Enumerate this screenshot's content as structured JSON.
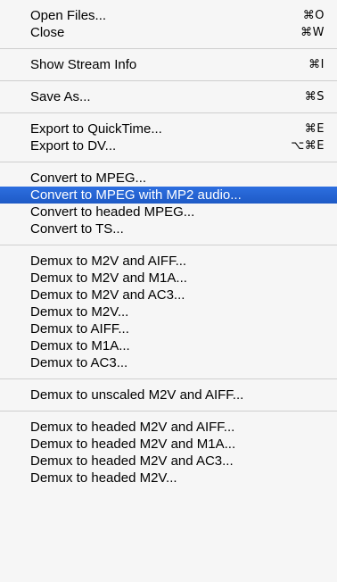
{
  "menu": {
    "groups": [
      [
        {
          "label": "Open Files...",
          "shortcut": "⌘O"
        },
        {
          "label": "Close",
          "shortcut": "⌘W"
        }
      ],
      [
        {
          "label": "Show Stream Info",
          "shortcut": "⌘I"
        }
      ],
      [
        {
          "label": "Save As...",
          "shortcut": "⌘S"
        }
      ],
      [
        {
          "label": "Export to QuickTime...",
          "shortcut": "⌘E"
        },
        {
          "label": "Export to DV...",
          "shortcut": "⌥⌘E"
        }
      ],
      [
        {
          "label": "Convert to MPEG...",
          "shortcut": ""
        },
        {
          "label": "Convert to MPEG with MP2 audio...",
          "shortcut": "",
          "selected": true
        },
        {
          "label": "Convert to headed MPEG...",
          "shortcut": ""
        },
        {
          "label": "Convert to TS...",
          "shortcut": ""
        }
      ],
      [
        {
          "label": "Demux to M2V and AIFF...",
          "shortcut": ""
        },
        {
          "label": "Demux to M2V and M1A...",
          "shortcut": ""
        },
        {
          "label": "Demux to M2V and AC3...",
          "shortcut": ""
        },
        {
          "label": "Demux to M2V...",
          "shortcut": ""
        },
        {
          "label": "Demux to AIFF...",
          "shortcut": ""
        },
        {
          "label": "Demux to M1A...",
          "shortcut": ""
        },
        {
          "label": "Demux to AC3...",
          "shortcut": ""
        }
      ],
      [
        {
          "label": "Demux to unscaled M2V and AIFF...",
          "shortcut": ""
        }
      ],
      [
        {
          "label": "Demux to headed M2V and AIFF...",
          "shortcut": ""
        },
        {
          "label": "Demux to headed M2V and M1A...",
          "shortcut": ""
        },
        {
          "label": "Demux to headed M2V and AC3...",
          "shortcut": ""
        },
        {
          "label": "Demux to headed M2V...",
          "shortcut": ""
        }
      ]
    ]
  },
  "colors": {
    "highlight": "#1f5fd0",
    "separator": "#cfcfcf",
    "background": "#f6f6f6"
  }
}
